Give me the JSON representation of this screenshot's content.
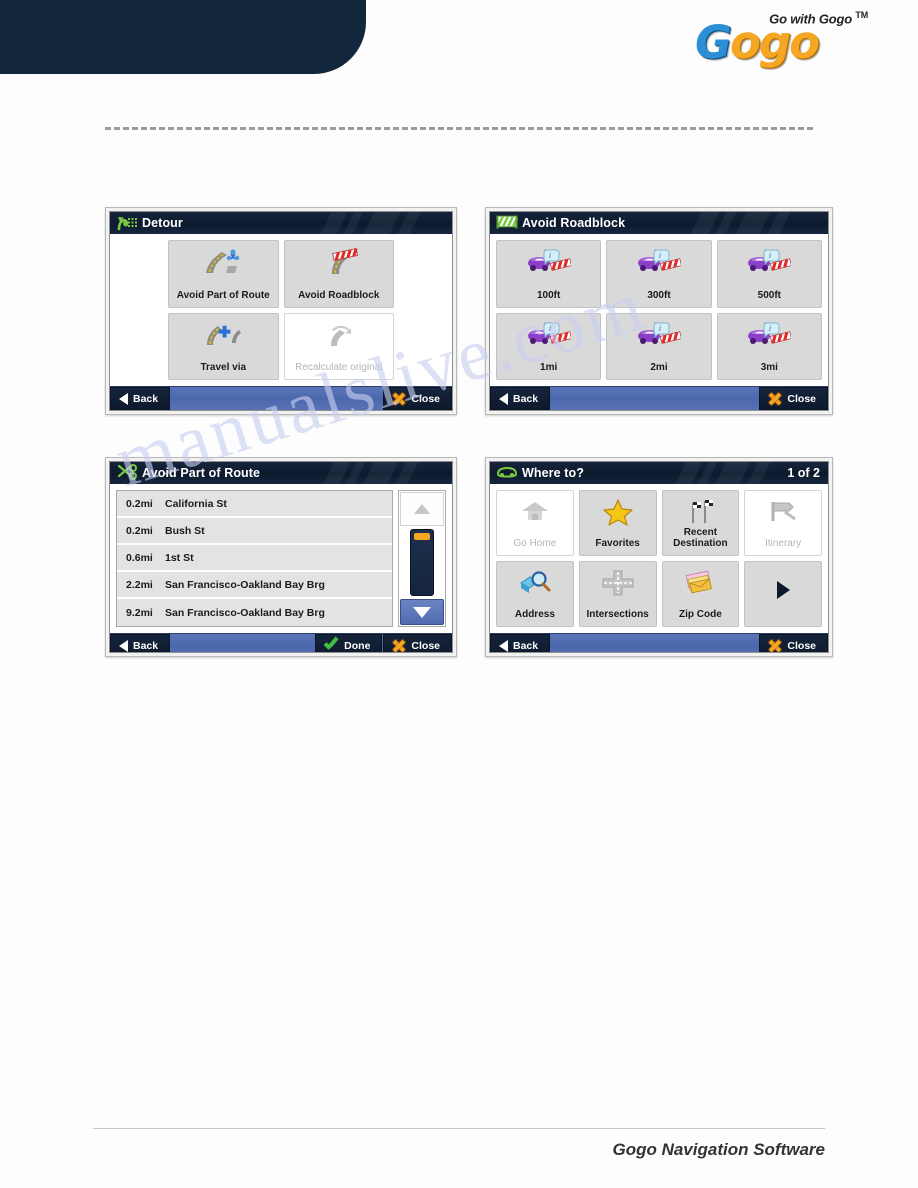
{
  "branding": {
    "tagline": "Go with Gogo",
    "tm": "TM",
    "logo_g1": "G",
    "logo_o1": "o",
    "logo_g2": "g",
    "logo_o2": "o",
    "footer": "Gogo Navigation Software",
    "accent_blue": "#2a8fd4",
    "accent_orange": "#f5a623",
    "header_navy": "#13273c"
  },
  "watermark": {
    "text": "manualslive.com"
  },
  "dialogs": {
    "detour": {
      "title": "Detour",
      "title_icon": "detour-arrow-icon",
      "tiles": [
        {
          "label": "Avoid Part of Route",
          "icon": "road-fork-icon",
          "disabled": false
        },
        {
          "label": "Avoid Roadblock",
          "icon": "road-barrier-icon",
          "disabled": false
        },
        {
          "label": "Travel via",
          "icon": "road-plus-icon",
          "disabled": false
        },
        {
          "label": "Recalculate original",
          "icon": "road-recalculate-icon",
          "disabled": true
        }
      ],
      "toolbar": {
        "back": "Back",
        "close": "Close"
      }
    },
    "avoid_roadblock": {
      "title": "Avoid Roadblock",
      "title_icon": "green-barrier-icon",
      "tiles": [
        {
          "label": "100ft",
          "icon": "car-barrier-info-icon"
        },
        {
          "label": "300ft",
          "icon": "car-barrier-info-icon"
        },
        {
          "label": "500ft",
          "icon": "car-barrier-info-icon"
        },
        {
          "label": "1mi",
          "icon": "car-barrier-info-icon"
        },
        {
          "label": "2mi",
          "icon": "car-barrier-info-icon"
        },
        {
          "label": "3mi",
          "icon": "car-barrier-info-icon"
        }
      ],
      "toolbar": {
        "back": "Back",
        "close": "Close"
      }
    },
    "avoid_part_of_route": {
      "title": "Avoid Part of Route",
      "title_icon": "green-scissors-icon",
      "rows": [
        {
          "distance": "0.2mi",
          "name": "California St"
        },
        {
          "distance": "0.2mi",
          "name": "Bush St"
        },
        {
          "distance": "0.6mi",
          "name": "1st St"
        },
        {
          "distance": "2.2mi",
          "name": "San Francisco-Oakland Bay Brg"
        },
        {
          "distance": "9.2mi",
          "name": "San Francisco-Oakland Bay Brg"
        }
      ],
      "scrollbar": {
        "up": "scroll-up-arrow",
        "down": "scroll-down-arrow"
      },
      "toolbar": {
        "back": "Back",
        "done": "Done",
        "close": "Close"
      }
    },
    "where_to": {
      "title": "Where to?",
      "title_icon": "green-car-icon",
      "page_indicator": "1 of 2",
      "tiles": [
        {
          "label": "Go Home",
          "icon": "home-icon",
          "disabled": true
        },
        {
          "label": "Favorites",
          "icon": "star-icon",
          "disabled": false
        },
        {
          "label": "Recent\nDestination",
          "icon": "checkered-flags-icon",
          "disabled": false
        },
        {
          "label": "Itinerary",
          "icon": "signpost-icon",
          "disabled": true
        },
        {
          "label": "Address",
          "icon": "mailbox-magnifier-icon",
          "disabled": false
        },
        {
          "label": "Intersections",
          "icon": "crossroad-icon",
          "disabled": false
        },
        {
          "label": "Zip Code",
          "icon": "envelopes-icon",
          "disabled": false
        },
        {
          "label": "",
          "icon": "next-page-arrow-icon",
          "disabled": false
        }
      ],
      "toolbar": {
        "back": "Back",
        "close": "Close"
      }
    }
  }
}
